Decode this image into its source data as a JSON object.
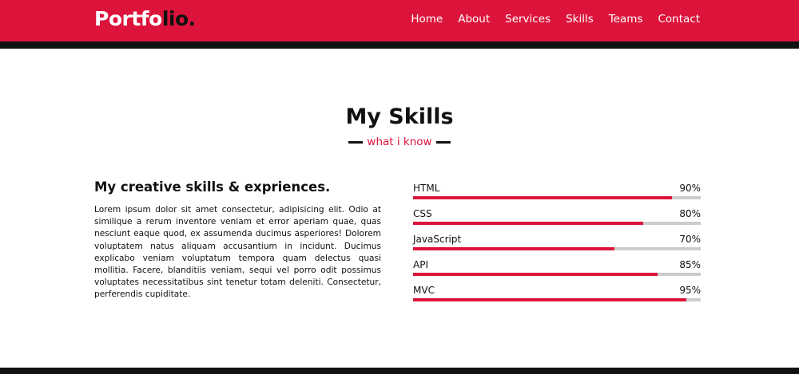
{
  "header": {
    "logo_light": "Portfo",
    "logo_dark": "lio.",
    "nav": [
      "Home",
      "About",
      "Services",
      "Skills",
      "Teams",
      "Contact"
    ]
  },
  "skills_section": {
    "title": "My Skills",
    "subtitle": "what i know",
    "heading": "My creative skills & expriences.",
    "paragraph": "Lorem ipsum dolor sit amet consectetur, adipisicing elit. Odio at similique a rerum inventore veniam et error aperiam quae, quas nesciunt eaque quod, ex assumenda ducimus asperiores! Dolorem voluptatem natus aliquam accusantium in incidunt. Ducimus explicabo veniam voluptatum tempora quam delectus quasi mollitia. Facere, blanditiis veniam, sequi vel porro odit possimus voluptates necessitatibus sint tenetur totam deleniti. Consectetur, perferendis cupiditate.",
    "skills": [
      {
        "name": "HTML",
        "percent_label": "90%",
        "level": 0.9
      },
      {
        "name": "CSS",
        "percent_label": "80%",
        "level": 0.8
      },
      {
        "name": "JavaScript",
        "percent_label": "70%",
        "level": 0.7
      },
      {
        "name": "API",
        "percent_label": "85%",
        "level": 0.85
      },
      {
        "name": "MVC",
        "percent_label": "95%",
        "level": 0.95
      }
    ]
  },
  "colors": {
    "accent": "#dc143c",
    "dark": "#111111",
    "track": "#cccccc"
  }
}
